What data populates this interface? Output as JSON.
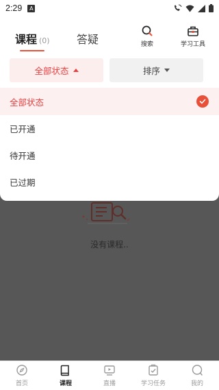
{
  "status_bar": {
    "time": "2:29",
    "a_badge": "A"
  },
  "header": {
    "tabs": [
      {
        "label": "课程",
        "count": "(0)"
      },
      {
        "label": "答疑"
      }
    ],
    "search_label": "搜索",
    "tools_label": "学习工具"
  },
  "filters": {
    "status_label": "全部状态",
    "sort_label": "排序"
  },
  "dropdown": {
    "items": [
      "全部状态",
      "已开通",
      "待开通",
      "已过期"
    ],
    "selected_index": 0
  },
  "empty_state": {
    "text": "没有课程.."
  },
  "bottom_nav": {
    "items": [
      {
        "label": "首页",
        "icon": "compass-icon"
      },
      {
        "label": "课程",
        "icon": "book-icon"
      },
      {
        "label": "直播",
        "icon": "live-icon"
      },
      {
        "label": "学习任务",
        "icon": "task-icon"
      },
      {
        "label": "我的",
        "icon": "profile-icon"
      }
    ],
    "active_index": 1
  },
  "colors": {
    "accent": "#e8503a",
    "overlay": "#575757"
  }
}
